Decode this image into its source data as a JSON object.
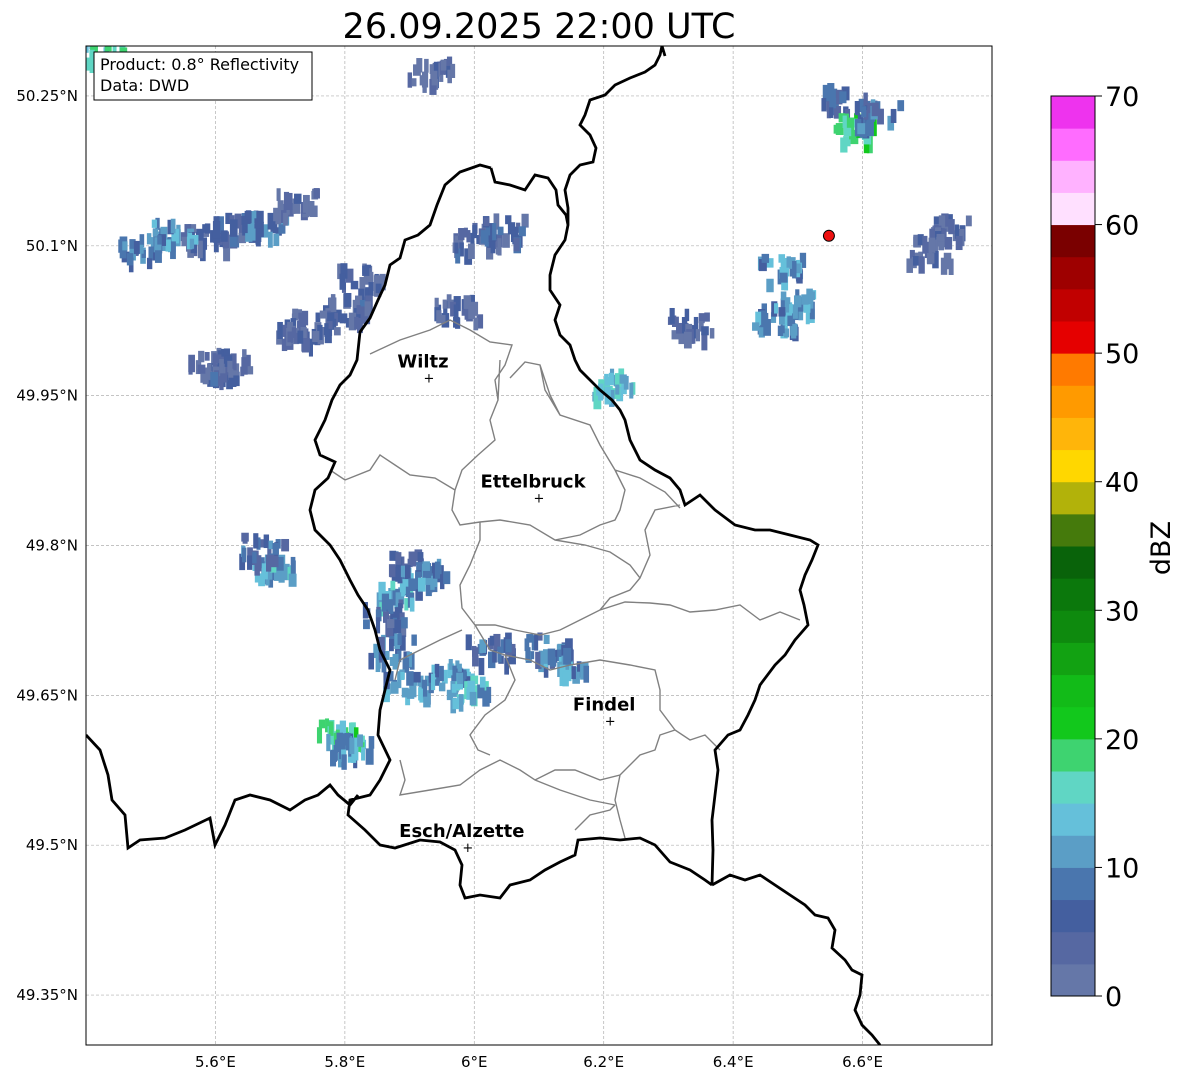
{
  "title": "26.09.2025 22:00 UTC",
  "info_box": {
    "line1": "Product: 0.8° Reflectivity",
    "line2": "Data: DWD"
  },
  "map": {
    "lon_range": [
      5.4,
      6.8
    ],
    "lat_range": [
      49.3,
      50.3
    ],
    "lon_ticks": [
      {
        "value": 5.6,
        "label": "5.6°E"
      },
      {
        "value": 5.8,
        "label": "5.8°E"
      },
      {
        "value": 6.0,
        "label": "6°E"
      },
      {
        "value": 6.2,
        "label": "6.2°E"
      },
      {
        "value": 6.4,
        "label": "6.4°E"
      },
      {
        "value": 6.6,
        "label": "6.6°E"
      }
    ],
    "lat_ticks": [
      {
        "value": 50.25,
        "label": "50.25°N"
      },
      {
        "value": 50.1,
        "label": "50.1°N"
      },
      {
        "value": 49.95,
        "label": "49.95°N"
      },
      {
        "value": 49.8,
        "label": "49.8°N"
      },
      {
        "value": 49.65,
        "label": "49.65°N"
      },
      {
        "value": 49.5,
        "label": "49.5°N"
      },
      {
        "value": 49.35,
        "label": "49.35°N"
      }
    ],
    "gridlines": true,
    "cities": [
      {
        "name": "Wiltz",
        "lon": 5.93,
        "lat": 49.968
      },
      {
        "name": "Ettelbruck",
        "lon": 6.1,
        "lat": 49.848
      },
      {
        "name": "Findel",
        "lon": 6.21,
        "lat": 49.625
      },
      {
        "name": "Esch/Alzette",
        "lon": 5.99,
        "lat": 49.498
      }
    ],
    "radar_site": {
      "lon": 6.548,
      "lat": 50.11,
      "color": "#ee1111"
    }
  },
  "colorbar": {
    "label": "dBZ",
    "range": [
      0,
      70
    ],
    "step": 2.5,
    "ticks": [
      {
        "value": 0,
        "label": "0"
      },
      {
        "value": 10,
        "label": "10"
      },
      {
        "value": 20,
        "label": "20"
      },
      {
        "value": 30,
        "label": "30"
      },
      {
        "value": 40,
        "label": "40"
      },
      {
        "value": 50,
        "label": "50"
      },
      {
        "value": 60,
        "label": "60"
      },
      {
        "value": 70,
        "label": "70"
      }
    ],
    "colors": [
      "#6577a8",
      "#5668a2",
      "#445f9f",
      "#4a76ae",
      "#5b9ec6",
      "#65c0da",
      "#60d6c4",
      "#3ed370",
      "#12c81c",
      "#12bb18",
      "#12a212",
      "#0e8a0e",
      "#0b780c",
      "#09630a",
      "#457a0c",
      "#b2b20a",
      "#ffd700",
      "#ffb50a",
      "#ff9a00",
      "#ff7a00",
      "#e50000",
      "#c10000",
      "#9e0000",
      "#7a0000",
      "#ffe0ff",
      "#ffb2ff",
      "#ff6cff",
      "#ee33ee"
    ]
  },
  "radar_cells": [
    {
      "lon": 5.58,
      "lat": 50.11,
      "dbz": 6
    },
    {
      "lon": 5.53,
      "lat": 50.115,
      "dbz": 12
    },
    {
      "lon": 5.48,
      "lat": 50.1,
      "dbz": 10
    },
    {
      "lon": 5.63,
      "lat": 50.12,
      "dbz": 7
    },
    {
      "lon": 5.67,
      "lat": 50.125,
      "dbz": 10
    },
    {
      "lon": 5.72,
      "lat": 50.145,
      "dbz": 4
    },
    {
      "lon": 5.82,
      "lat": 50.07,
      "dbz": 5
    },
    {
      "lon": 5.8,
      "lat": 50.04,
      "dbz": 6
    },
    {
      "lon": 5.75,
      "lat": 50.025,
      "dbz": 5
    },
    {
      "lon": 5.72,
      "lat": 50.015,
      "dbz": 4
    },
    {
      "lon": 5.62,
      "lat": 49.985,
      "dbz": 5
    },
    {
      "lon": 5.59,
      "lat": 49.985,
      "dbz": 6
    },
    {
      "lon": 5.97,
      "lat": 50.04,
      "dbz": 5
    },
    {
      "lon": 6.0,
      "lat": 50.11,
      "dbz": 6
    },
    {
      "lon": 6.04,
      "lat": 50.12,
      "dbz": 8
    },
    {
      "lon": 5.93,
      "lat": 50.28,
      "dbz": 5
    },
    {
      "lon": 5.42,
      "lat": 50.3,
      "dbz": 18
    },
    {
      "lon": 5.69,
      "lat": 49.78,
      "dbz": 14
    },
    {
      "lon": 5.67,
      "lat": 49.8,
      "dbz": 9
    },
    {
      "lon": 5.9,
      "lat": 49.785,
      "dbz": 9
    },
    {
      "lon": 5.92,
      "lat": 49.775,
      "dbz": 11
    },
    {
      "lon": 5.88,
      "lat": 49.755,
      "dbz": 14
    },
    {
      "lon": 5.86,
      "lat": 49.735,
      "dbz": 8
    },
    {
      "lon": 5.87,
      "lat": 49.7,
      "dbz": 10
    },
    {
      "lon": 5.89,
      "lat": 49.665,
      "dbz": 13
    },
    {
      "lon": 5.96,
      "lat": 49.675,
      "dbz": 12
    },
    {
      "lon": 5.985,
      "lat": 49.66,
      "dbz": 15
    },
    {
      "lon": 6.02,
      "lat": 49.7,
      "dbz": 9
    },
    {
      "lon": 6.11,
      "lat": 49.7,
      "dbz": 10
    },
    {
      "lon": 6.135,
      "lat": 49.685,
      "dbz": 12
    },
    {
      "lon": 5.79,
      "lat": 49.615,
      "dbz": 19
    },
    {
      "lon": 5.805,
      "lat": 49.6,
      "dbz": 12
    },
    {
      "lon": 6.21,
      "lat": 49.965,
      "dbz": 15
    },
    {
      "lon": 6.33,
      "lat": 50.025,
      "dbz": 6
    },
    {
      "lon": 6.46,
      "lat": 50.03,
      "dbz": 11
    },
    {
      "lon": 6.49,
      "lat": 50.045,
      "dbz": 13
    },
    {
      "lon": 6.57,
      "lat": 50.25,
      "dbz": 8
    },
    {
      "lon": 6.58,
      "lat": 50.22,
      "dbz": 20
    },
    {
      "lon": 6.62,
      "lat": 50.235,
      "dbz": 9
    },
    {
      "lon": 6.73,
      "lat": 50.12,
      "dbz": 5
    },
    {
      "lon": 6.7,
      "lat": 50.1,
      "dbz": 4
    },
    {
      "lon": 6.47,
      "lat": 50.08,
      "dbz": 13
    }
  ]
}
